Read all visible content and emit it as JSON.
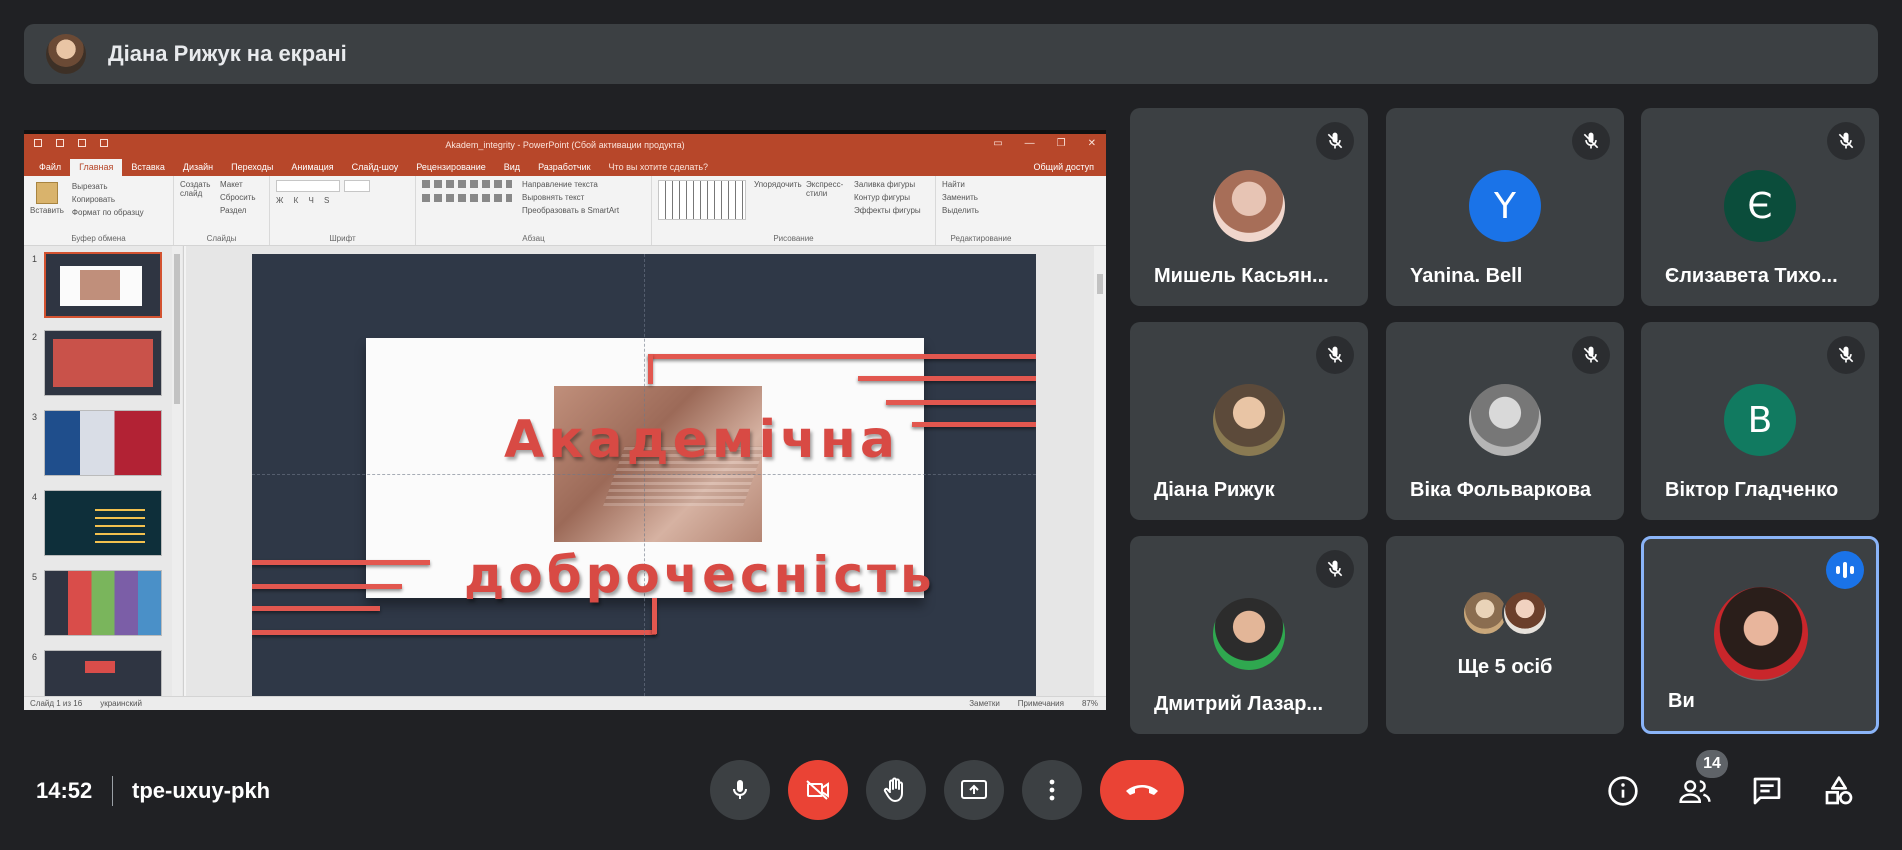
{
  "banner": {
    "presenter_text": "Діана Рижук на екрані"
  },
  "powerpoint": {
    "window_title": "Akadem_integrity - PowerPoint (Сбой активации продукта)",
    "tabs": [
      "Файл",
      "Главная",
      "Вставка",
      "Дизайн",
      "Переходы",
      "Анимация",
      "Слайд-шоу",
      "Рецензирование",
      "Вид",
      "Разработчик"
    ],
    "active_tab": "Главная",
    "tell_me": "Что вы хотите сделать?",
    "share": "Общий доступ",
    "ribbon": {
      "clipboard": {
        "paste": "Вставить",
        "cut": "Вырезать",
        "copy": "Копировать",
        "format_painter": "Формат по образцу",
        "label": "Буфер обмена"
      },
      "slides": {
        "new_slide": "Создать слайд",
        "layout": "Макет",
        "reset": "Сбросить",
        "section": "Раздел",
        "label": "Слайды"
      },
      "font": {
        "label": "Шрифт"
      },
      "paragraph": {
        "text_direction": "Направление текста",
        "align_text": "Выровнять текст",
        "smartart": "Преобразовать в SmartArt",
        "label": "Абзац"
      },
      "drawing": {
        "arrange": "Упорядочить",
        "quick_styles": "Экспресс-стили",
        "fill": "Заливка фигуры",
        "outline": "Контур фигуры",
        "effects": "Эффекты фигуры",
        "label": "Рисование"
      },
      "editing": {
        "find": "Найти",
        "replace": "Заменить",
        "select": "Выделить",
        "label": "Редактирование"
      }
    },
    "slide_numbers": [
      "1",
      "2",
      "3",
      "4",
      "5",
      "6"
    ],
    "slide": {
      "line1": "Академічна",
      "line2": "доброчесність"
    },
    "status": {
      "slide_of": "Слайд 1 из 16",
      "language": "украинский",
      "notes": "Заметки",
      "comments": "Примечания",
      "zoom": "87%"
    }
  },
  "participants": [
    {
      "name": "Мишель Касьян...",
      "initial": "",
      "muted": true
    },
    {
      "name": "Yanina. Bell",
      "initial": "Y",
      "color": "#1a73e8",
      "muted": true
    },
    {
      "name": "Єлизавета Тихо...",
      "initial": "Є",
      "color": "#0b4d3b",
      "muted": true
    },
    {
      "name": "Діана Рижук",
      "initial": "",
      "muted": true
    },
    {
      "name": "Віка Фольваркова",
      "initial": "",
      "muted": true
    },
    {
      "name": "Віктор Гладченко",
      "initial": "B",
      "color": "#117a60",
      "muted": true
    },
    {
      "name": "Дмитрий Лазар...",
      "initial": "",
      "muted": true
    },
    {
      "name": "Ще 5 осіб",
      "initial": "",
      "muted": false
    },
    {
      "name": "Ви",
      "initial": "",
      "muted": false
    }
  ],
  "bottom_bar": {
    "time": "14:52",
    "meeting_code": "tpe-uxuy-pkh",
    "people_count": "14"
  },
  "colors": {
    "background": "#202124",
    "tile": "#3c4043",
    "red": "#ea4335",
    "blue": "#1a73e8",
    "powerpoint": "#b7472a"
  }
}
